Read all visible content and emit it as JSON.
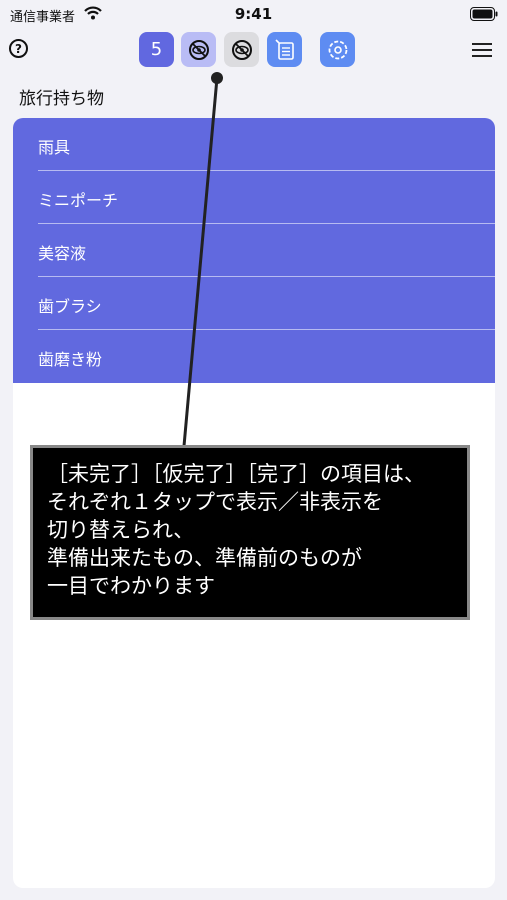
{
  "status_bar": {
    "carrier": "通信事業者",
    "time": "9:41"
  },
  "toolbar": {
    "help_label": "?",
    "count_badge": "5"
  },
  "page": {
    "title": "旅行持ち物"
  },
  "items": [
    {
      "label": "雨具"
    },
    {
      "label": "ミニポーチ"
    },
    {
      "label": "美容液"
    },
    {
      "label": "歯ブラシ"
    },
    {
      "label": "歯磨き粉"
    }
  ],
  "callout": {
    "lines": [
      "［未完了］［仮完了］［完了］の項目は、",
      "それぞれ１タップで表示／非表示を",
      "切り替えられ、",
      "準備出来たもの、準備前のものが",
      "一目でわかります"
    ]
  },
  "colors": {
    "list_background": "#6169df",
    "accent_blue": "#5e8cf2",
    "eye_active": "#b9bcf5",
    "eye_inactive": "#dcdcdf"
  }
}
